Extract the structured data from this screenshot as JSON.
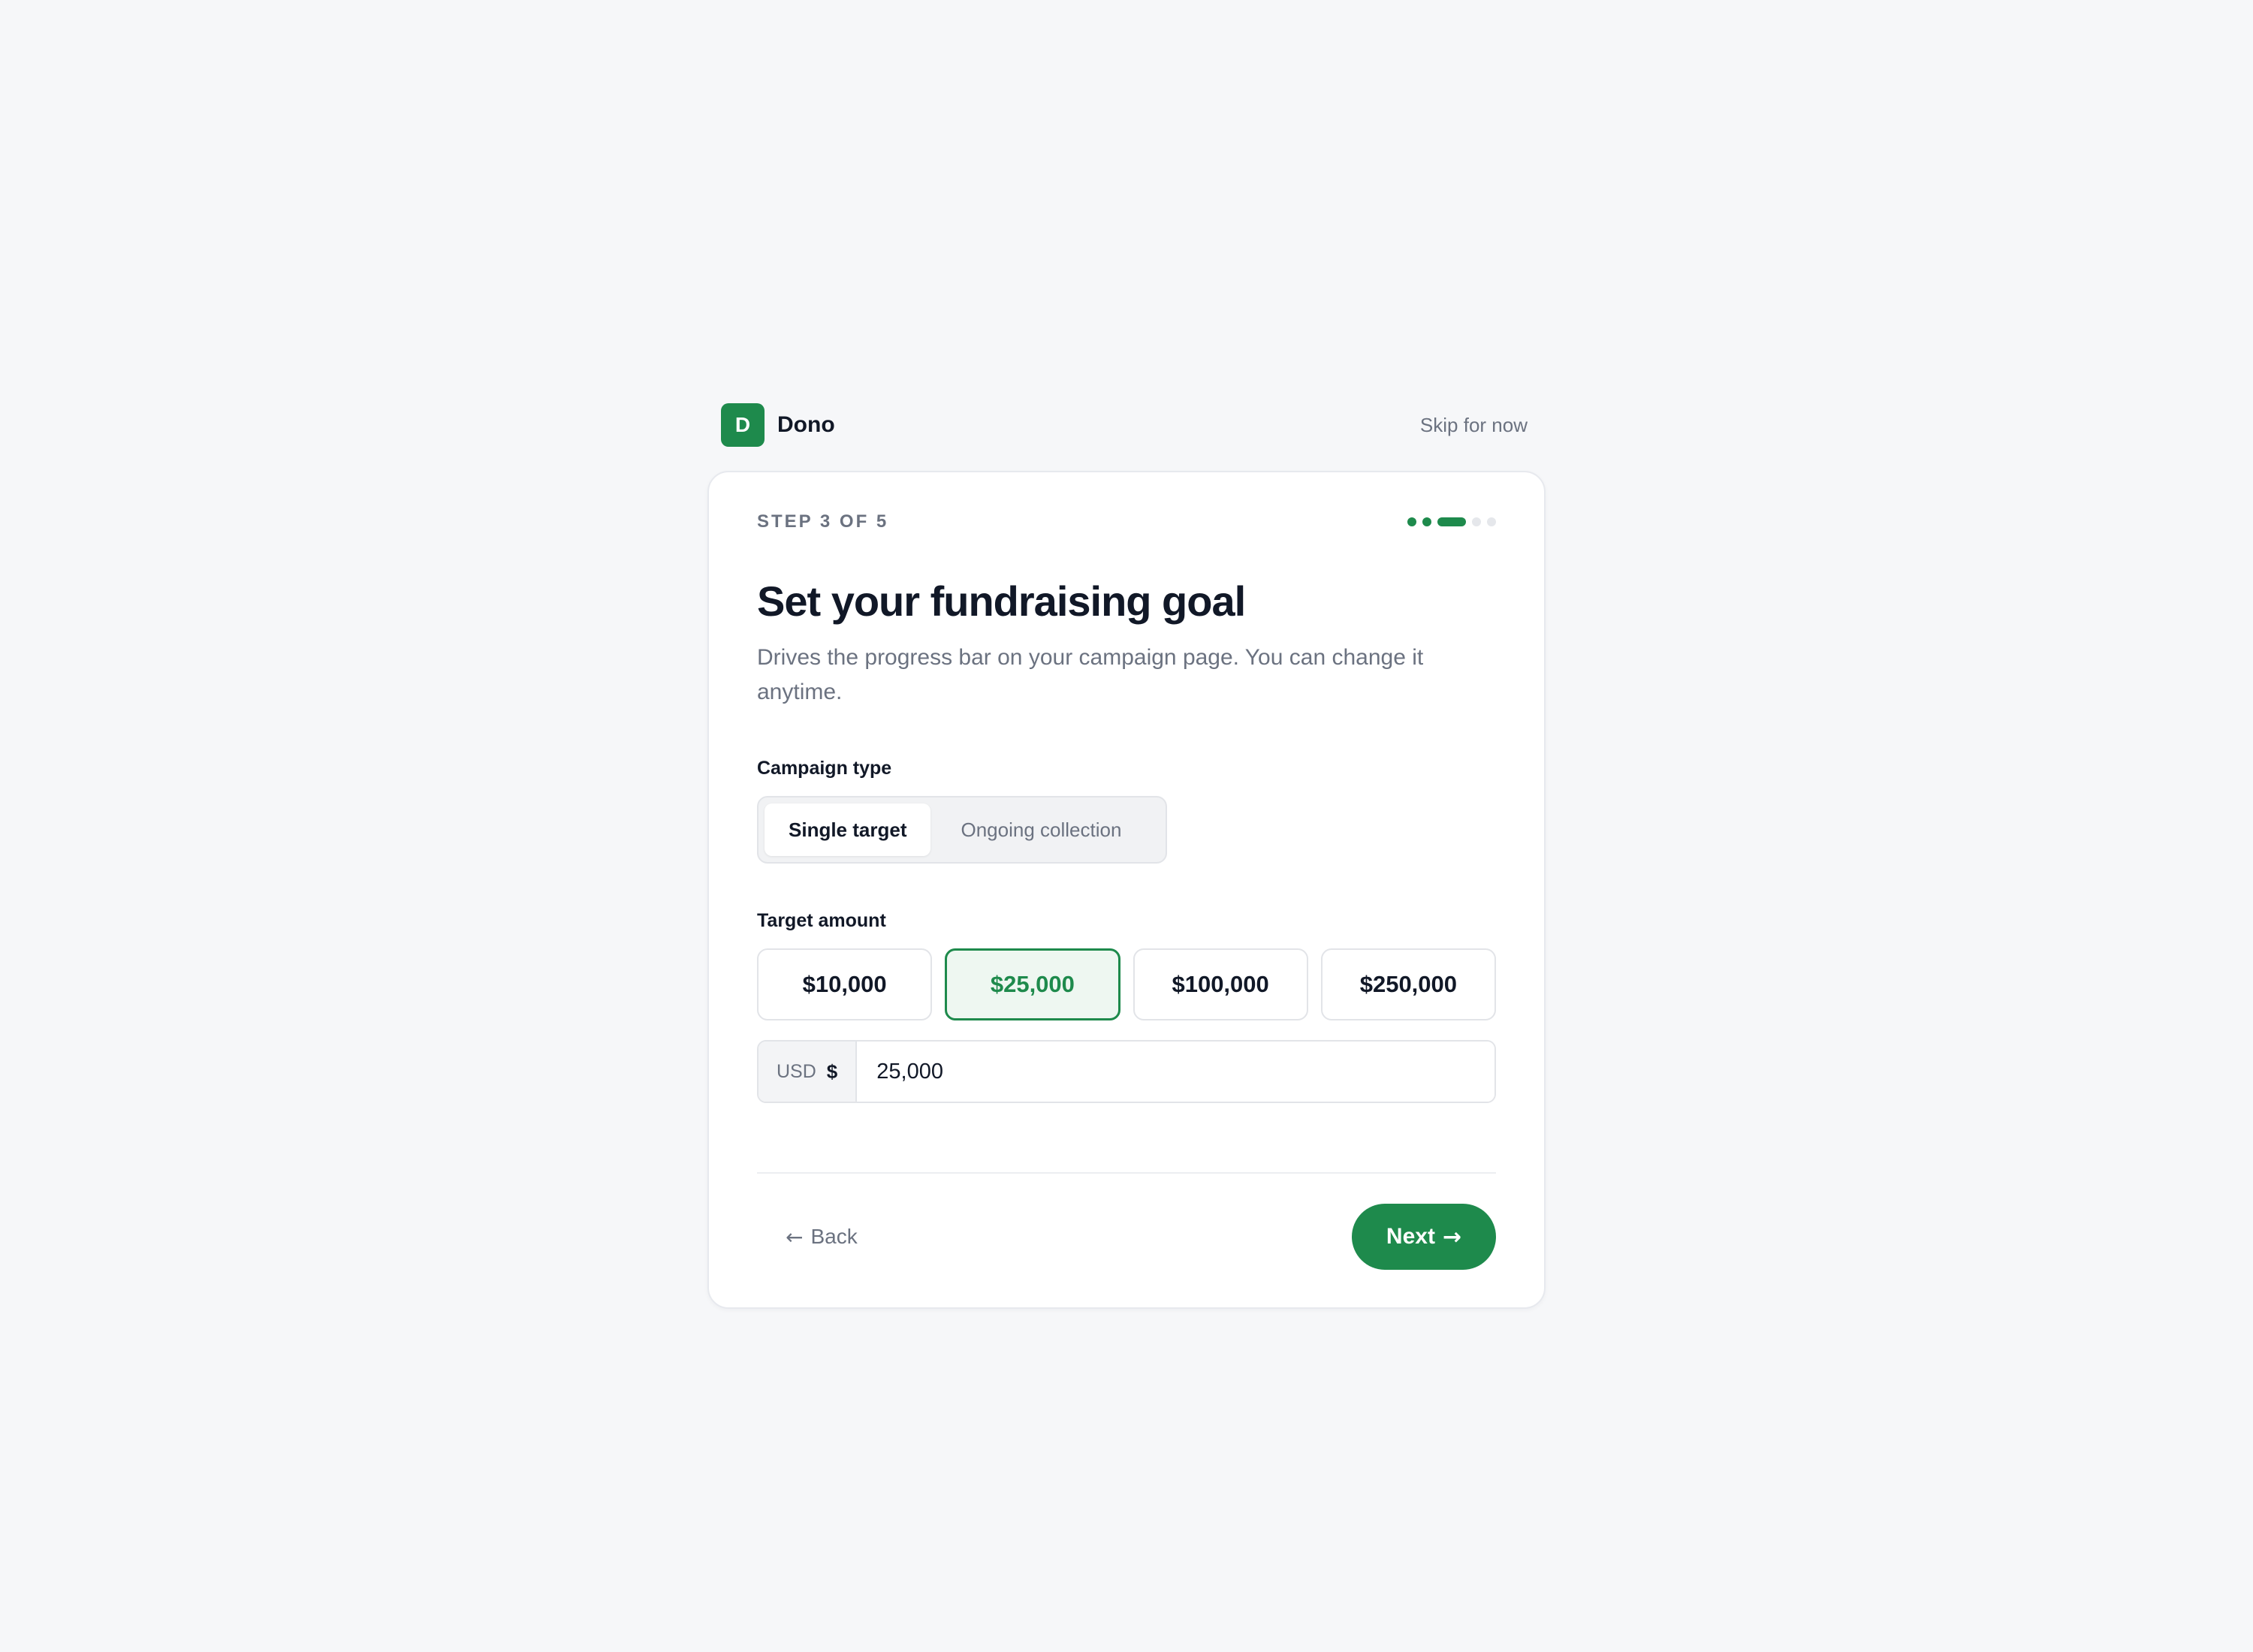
{
  "brand": {
    "initial": "D",
    "name": "Dono"
  },
  "header": {
    "skip_label": "Skip for now"
  },
  "progress": {
    "label": "STEP 3 OF 5",
    "current_step": 3,
    "total_steps": 5
  },
  "page": {
    "title": "Set your fundraising goal",
    "subtitle": "Drives the progress bar on your campaign page. You can change it anytime."
  },
  "campaign_type": {
    "label": "Campaign type",
    "options": [
      "Single target",
      "Ongoing collection"
    ],
    "selected": "Single target"
  },
  "target_amount": {
    "label": "Target amount",
    "presets": [
      "$10,000",
      "$25,000",
      "$100,000",
      "$250,000"
    ],
    "selected": "$25,000",
    "currency": "USD",
    "symbol": "$",
    "value": "25,000"
  },
  "footer": {
    "back_label": "Back",
    "next_label": "Next"
  },
  "icons": {
    "back": "arrow-left-icon",
    "next": "arrow-right-icon"
  },
  "colors": {
    "accent": "#1e8a4c",
    "accent_tint": "#eef7f1",
    "background": "#f6f7f9"
  }
}
